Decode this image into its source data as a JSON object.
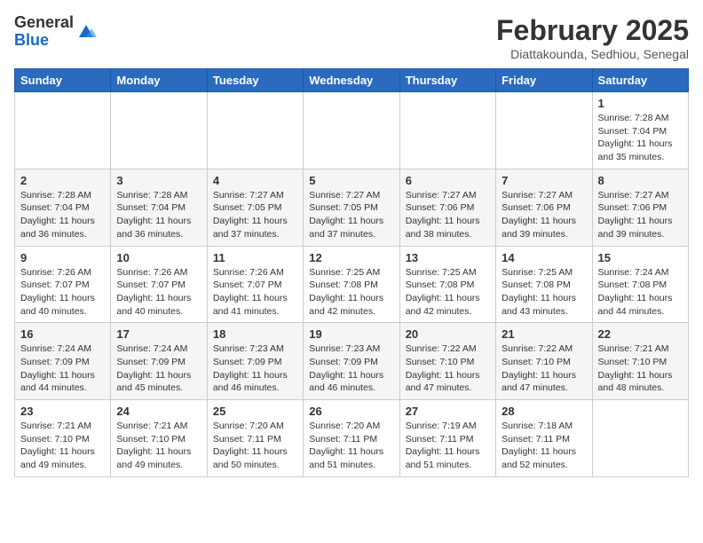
{
  "header": {
    "logo_general": "General",
    "logo_blue": "Blue",
    "month_year": "February 2025",
    "location": "Diattakounda, Sedhiou, Senegal"
  },
  "calendar": {
    "days_of_week": [
      "Sunday",
      "Monday",
      "Tuesday",
      "Wednesday",
      "Thursday",
      "Friday",
      "Saturday"
    ],
    "weeks": [
      [
        {
          "day": "",
          "info": ""
        },
        {
          "day": "",
          "info": ""
        },
        {
          "day": "",
          "info": ""
        },
        {
          "day": "",
          "info": ""
        },
        {
          "day": "",
          "info": ""
        },
        {
          "day": "",
          "info": ""
        },
        {
          "day": "1",
          "info": "Sunrise: 7:28 AM\nSunset: 7:04 PM\nDaylight: 11 hours and 35 minutes."
        }
      ],
      [
        {
          "day": "2",
          "info": "Sunrise: 7:28 AM\nSunset: 7:04 PM\nDaylight: 11 hours and 36 minutes."
        },
        {
          "day": "3",
          "info": "Sunrise: 7:28 AM\nSunset: 7:04 PM\nDaylight: 11 hours and 36 minutes."
        },
        {
          "day": "4",
          "info": "Sunrise: 7:27 AM\nSunset: 7:05 PM\nDaylight: 11 hours and 37 minutes."
        },
        {
          "day": "5",
          "info": "Sunrise: 7:27 AM\nSunset: 7:05 PM\nDaylight: 11 hours and 37 minutes."
        },
        {
          "day": "6",
          "info": "Sunrise: 7:27 AM\nSunset: 7:06 PM\nDaylight: 11 hours and 38 minutes."
        },
        {
          "day": "7",
          "info": "Sunrise: 7:27 AM\nSunset: 7:06 PM\nDaylight: 11 hours and 39 minutes."
        },
        {
          "day": "8",
          "info": "Sunrise: 7:27 AM\nSunset: 7:06 PM\nDaylight: 11 hours and 39 minutes."
        }
      ],
      [
        {
          "day": "9",
          "info": "Sunrise: 7:26 AM\nSunset: 7:07 PM\nDaylight: 11 hours and 40 minutes."
        },
        {
          "day": "10",
          "info": "Sunrise: 7:26 AM\nSunset: 7:07 PM\nDaylight: 11 hours and 40 minutes."
        },
        {
          "day": "11",
          "info": "Sunrise: 7:26 AM\nSunset: 7:07 PM\nDaylight: 11 hours and 41 minutes."
        },
        {
          "day": "12",
          "info": "Sunrise: 7:25 AM\nSunset: 7:08 PM\nDaylight: 11 hours and 42 minutes."
        },
        {
          "day": "13",
          "info": "Sunrise: 7:25 AM\nSunset: 7:08 PM\nDaylight: 11 hours and 42 minutes."
        },
        {
          "day": "14",
          "info": "Sunrise: 7:25 AM\nSunset: 7:08 PM\nDaylight: 11 hours and 43 minutes."
        },
        {
          "day": "15",
          "info": "Sunrise: 7:24 AM\nSunset: 7:08 PM\nDaylight: 11 hours and 44 minutes."
        }
      ],
      [
        {
          "day": "16",
          "info": "Sunrise: 7:24 AM\nSunset: 7:09 PM\nDaylight: 11 hours and 44 minutes."
        },
        {
          "day": "17",
          "info": "Sunrise: 7:24 AM\nSunset: 7:09 PM\nDaylight: 11 hours and 45 minutes."
        },
        {
          "day": "18",
          "info": "Sunrise: 7:23 AM\nSunset: 7:09 PM\nDaylight: 11 hours and 46 minutes."
        },
        {
          "day": "19",
          "info": "Sunrise: 7:23 AM\nSunset: 7:09 PM\nDaylight: 11 hours and 46 minutes."
        },
        {
          "day": "20",
          "info": "Sunrise: 7:22 AM\nSunset: 7:10 PM\nDaylight: 11 hours and 47 minutes."
        },
        {
          "day": "21",
          "info": "Sunrise: 7:22 AM\nSunset: 7:10 PM\nDaylight: 11 hours and 47 minutes."
        },
        {
          "day": "22",
          "info": "Sunrise: 7:21 AM\nSunset: 7:10 PM\nDaylight: 11 hours and 48 minutes."
        }
      ],
      [
        {
          "day": "23",
          "info": "Sunrise: 7:21 AM\nSunset: 7:10 PM\nDaylight: 11 hours and 49 minutes."
        },
        {
          "day": "24",
          "info": "Sunrise: 7:21 AM\nSunset: 7:10 PM\nDaylight: 11 hours and 49 minutes."
        },
        {
          "day": "25",
          "info": "Sunrise: 7:20 AM\nSunset: 7:11 PM\nDaylight: 11 hours and 50 minutes."
        },
        {
          "day": "26",
          "info": "Sunrise: 7:20 AM\nSunset: 7:11 PM\nDaylight: 11 hours and 51 minutes."
        },
        {
          "day": "27",
          "info": "Sunrise: 7:19 AM\nSunset: 7:11 PM\nDaylight: 11 hours and 51 minutes."
        },
        {
          "day": "28",
          "info": "Sunrise: 7:18 AM\nSunset: 7:11 PM\nDaylight: 11 hours and 52 minutes."
        },
        {
          "day": "",
          "info": ""
        }
      ]
    ]
  }
}
